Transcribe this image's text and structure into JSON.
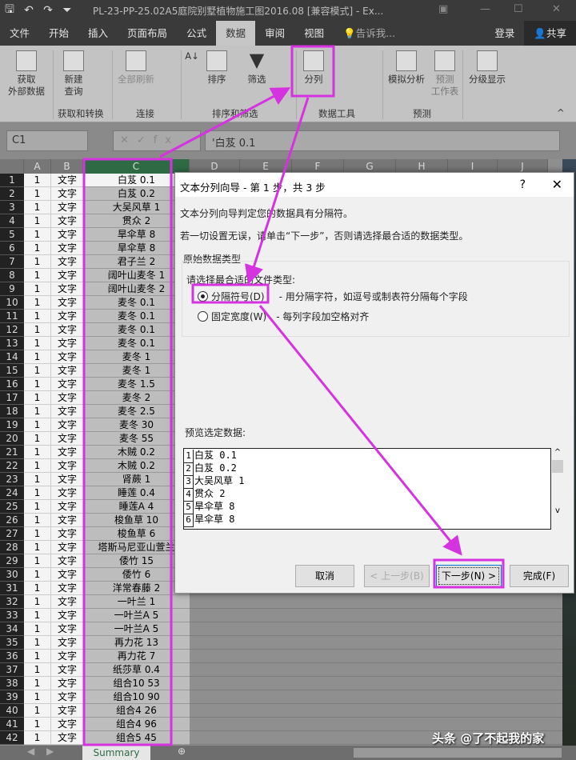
{
  "window": {
    "title": "PL-23-PP-25.02A5庭院别墅植物施工图2016.08  [兼容模式] - Ex..."
  },
  "tabs": [
    "文件",
    "开始",
    "插入",
    "页面布局",
    "公式",
    "数据",
    "审阅",
    "视图"
  ],
  "active_tab": "数据",
  "tell_me": "告诉我...",
  "login": "登录",
  "share": "共享",
  "ribbon": {
    "get_external": "获取\n外部数据",
    "new_query": "新建\n查询",
    "refresh_all": "全部刷新",
    "sort": "排序",
    "filter": "筛选",
    "text_to_columns": "分列",
    "what_if": "模拟分析",
    "forecast_sheet": "预测\n工作表",
    "outline": "分级显示",
    "groups": [
      "获取和转换",
      "连接",
      "排序和筛选",
      "数据工具",
      "预测"
    ]
  },
  "formula_bar": {
    "name_box": "C1",
    "formula": "'白芨 0.1",
    "fx": "fx"
  },
  "columns": [
    "A",
    "B",
    "C",
    "D",
    "E",
    "F",
    "G",
    "H",
    "I",
    "J"
  ],
  "rows_col_a": "1",
  "rows_col_b": "文字",
  "col_c": [
    "白芨 0.1",
    "白芨 0.2",
    "大吴风草 1",
    "贯众 2",
    "旱伞草 8",
    "旱伞草 8",
    "君子兰 2",
    "阔叶山麦冬 1",
    "阔叶山麦冬 2",
    "麦冬 0.1",
    "麦冬 0.1",
    "麦冬 0.1",
    "麦冬 0.1",
    "麦冬 1",
    "麦冬 1",
    "麦冬 1.5",
    "麦冬 2",
    "麦冬 2.5",
    "麦冬 30",
    "麦冬 55",
    "木贼 0.2",
    "木贼 0.2",
    "肾蕨 1",
    "睡莲 0.4",
    "睡莲A 4",
    "梭鱼草 10",
    "梭鱼草 6",
    "塔斯马尼亚山萱兰",
    "倭竹 15",
    "倭竹 6",
    "洋常春藤 2",
    "一叶兰 1",
    "一叶兰A 5",
    "一叶兰A 5",
    "再力花 13",
    "再力花 7",
    "纸莎草 0.4",
    "组合10 53",
    "组合10 90",
    "组合4 26",
    "组合4 96",
    "组合5 45"
  ],
  "sheet_tab": "Summary",
  "dialog": {
    "title": "文本分列向导 - 第 1 步，共 3 步",
    "help": "?",
    "line1": "文本分列向导判定您的数据具有分隔符。",
    "line2": "若一切设置无误，请单击“下一步”，否则请选择最合适的数据类型。",
    "group_label": "原始数据类型",
    "choose_label": "请选择最合适的文件类型:",
    "option_delimited": "分隔符号(D)",
    "option_delimited_desc": "- 用分隔字符，如逗号或制表符分隔每个字段",
    "option_fixed": "固定宽度(W)",
    "option_fixed_desc": "- 每列字段加空格对齐",
    "selected_option": "分隔符号(D)",
    "preview_label": "预览选定数据:",
    "preview": [
      "白芨 0.1",
      "白芨 0.2",
      "大吴风草 1",
      "贯众 2",
      "旱伞草 8",
      "旱伞草 8"
    ],
    "cancel": "取消",
    "back": "< 上一步(B)",
    "next": "下一步(N) >",
    "finish": "完成(F)"
  },
  "watermark": "头条 @了不起我的家",
  "accent_color": "#d633e0"
}
